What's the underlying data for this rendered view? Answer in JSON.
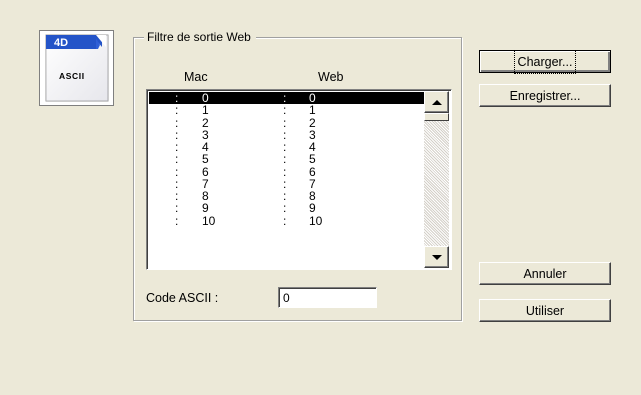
{
  "icon": {
    "name": "ascii-4d-icon",
    "badge_text": "4D",
    "label_text": "ASCII",
    "colors": {
      "badge": "#2454c8",
      "page": "#ffffff"
    }
  },
  "group": {
    "title": "Filtre de sortie Web"
  },
  "columns": {
    "mac": "Mac",
    "web": "Web"
  },
  "list": {
    "selected_index": 0,
    "separator": ":",
    "rows": [
      {
        "mac": "0",
        "web": "0"
      },
      {
        "mac": "1",
        "web": "1"
      },
      {
        "mac": "2",
        "web": "2"
      },
      {
        "mac": "3",
        "web": "3"
      },
      {
        "mac": "4",
        "web": "4"
      },
      {
        "mac": "5",
        "web": "5"
      },
      {
        "mac": "6",
        "web": "6"
      },
      {
        "mac": "7",
        "web": "7"
      },
      {
        "mac": "8",
        "web": "8"
      },
      {
        "mac": "9",
        "web": "9"
      },
      {
        "mac": "10",
        "web": "10"
      }
    ]
  },
  "ascii_code": {
    "label": "Code ASCII :",
    "value": "0"
  },
  "buttons": {
    "load": "Charger...",
    "save": "Enregistrer...",
    "cancel": "Annuler",
    "apply": "Utiliser"
  },
  "colors": {
    "background": "#ece9d8",
    "selection": "#000000"
  }
}
